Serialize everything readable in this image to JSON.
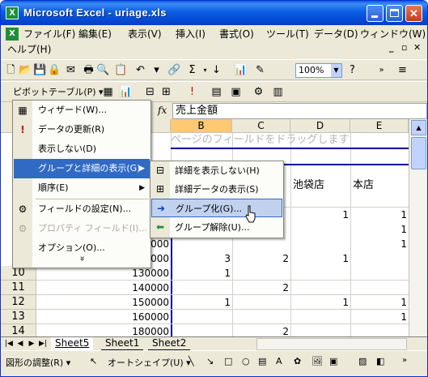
{
  "window": {
    "title": "Microsoft Excel - uriage.xls",
    "app_icon": "X"
  },
  "menubar": {
    "items": [
      "ファイル(F)",
      "編集(E)",
      "表示(V)",
      "挿入(I)",
      "書式(O)",
      "ツール(T)",
      "データ(D)",
      "ウィンドウ(W)",
      "ヘルプ(H)"
    ]
  },
  "toolbar": {
    "zoom": "100%",
    "pivot_label": "ピボットテーブル(P) ▾"
  },
  "formula_bar": {
    "fx": "fx",
    "value": "売上金額"
  },
  "sheet": {
    "columns": [
      "B",
      "C",
      "D",
      "E"
    ],
    "selected_column": "B",
    "drop_hint": "ページのフィールドをドラッグします",
    "header_cells": [
      "池袋店",
      "本店"
    ],
    "row_numbers": [
      "10",
      "11",
      "12",
      "13",
      "14"
    ],
    "col_a_values": [
      "0000",
      "0000",
      "0000",
      "0000",
      "130000",
      "140000",
      "150000",
      "160000",
      "180000"
    ],
    "col_b_values": [
      "",
      "",
      "",
      "3",
      "1",
      "",
      "1",
      "",
      ""
    ],
    "col_c_values": [
      "",
      "",
      "",
      "2",
      "",
      "2",
      "",
      "",
      "2"
    ],
    "col_d_values": [
      "1",
      "",
      "",
      "1",
      "",
      "",
      "1",
      "",
      ""
    ],
    "col_e_values": [
      "1",
      "1",
      "1",
      "",
      "",
      "",
      "1",
      "1",
      ""
    ]
  },
  "tabs": {
    "items": [
      "Sheet5",
      "Sheet1",
      "Sheet2"
    ],
    "active": "Sheet5"
  },
  "drawing_toolbar": {
    "adjust": "図形の調整(R) ▾",
    "autoshape": "オートシェイプ(U) ▾"
  },
  "pivot_menu": {
    "items": [
      {
        "label": "ウィザード(W)...",
        "icon": "wizard-icon"
      },
      {
        "label": "データの更新(R)",
        "icon": "refresh-icon"
      },
      {
        "label": "表示しない(D)",
        "icon": ""
      },
      {
        "label": "グループと詳細の表示(G)",
        "icon": "",
        "submenu": true
      },
      {
        "label": "順序(E)",
        "icon": "",
        "submenu": true
      },
      {
        "label": "フィールドの設定(N)...",
        "icon": "field-settings-icon"
      },
      {
        "label": "プロパティ フィールド(I)...",
        "icon": "property-field-icon",
        "disabled": true
      },
      {
        "label": "オプション(O)...",
        "icon": ""
      }
    ],
    "more": "»"
  },
  "group_submenu": {
    "items": [
      {
        "label": "詳細を表示しない(H)",
        "icon": "hide-detail-icon"
      },
      {
        "label": "詳細データの表示(S)",
        "icon": "show-detail-icon"
      },
      {
        "label": "グループ化(G)...",
        "icon": "group-icon"
      },
      {
        "label": "グループ解除(U)...",
        "icon": "ungroup-icon"
      }
    ]
  },
  "colors": {
    "highlight": "#316ac5",
    "submenu_highlight": "#c1d2ee",
    "title_blue": "#0b5ee2",
    "pivot_line": "#0000a0"
  }
}
